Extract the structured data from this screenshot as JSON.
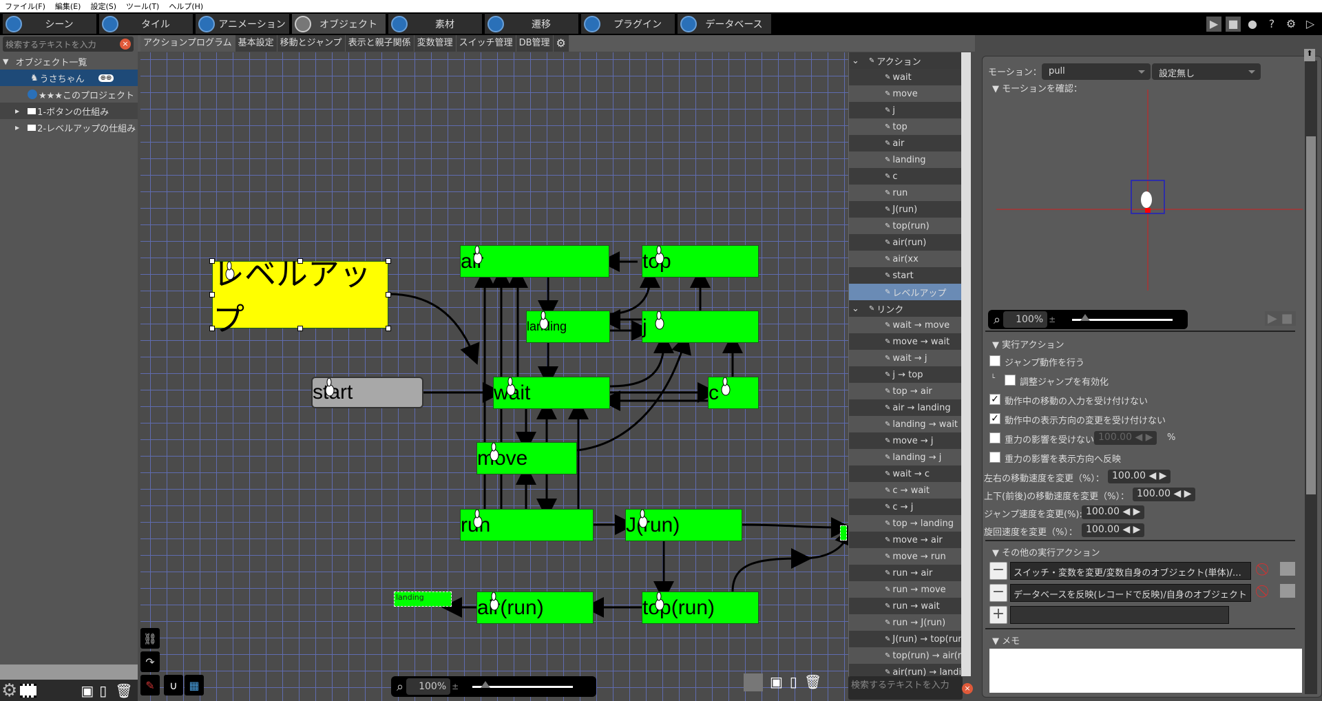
{
  "menu": [
    "ファイル(F)",
    "編集(E)",
    "設定(S)",
    "ツール(T)",
    "ヘルプ(H)"
  ],
  "main_tabs": [
    {
      "label": "シーン",
      "icon": "scene-icon"
    },
    {
      "label": "タイル",
      "icon": "tile-icon"
    },
    {
      "label": "アニメーション",
      "icon": "animation-icon"
    },
    {
      "label": "オブジェクト",
      "icon": "object-icon",
      "active": true
    },
    {
      "label": "素材",
      "icon": "material-icon"
    },
    {
      "label": "遷移",
      "icon": "transition-icon"
    },
    {
      "label": "プラグイン",
      "icon": "plugin-icon"
    },
    {
      "label": "データベース",
      "icon": "database-icon"
    }
  ],
  "left": {
    "search_placeholder": "検索するテキストを入力",
    "tree": [
      {
        "label": "オブジェクト一覧",
        "expanded": true
      },
      {
        "label": "うさちゃん",
        "selected": true,
        "badge": "gamepad-icon"
      },
      {
        "label": "★★★このプロジェクト"
      },
      {
        "label": "1-ボタンの仕組み",
        "folder": true
      },
      {
        "label": "2-レベルアップの仕組み",
        "folder": true
      }
    ]
  },
  "sub_tabs": [
    "アクションプログラム",
    "基本設定",
    "移動とジャンプ",
    "表示と親子関係",
    "変数管理",
    "スイッチ管理",
    "DB管理"
  ],
  "graph": {
    "nodes": [
      {
        "id": "levelup",
        "label": "レベルアップ",
        "color": "#ffff00",
        "selected": true
      },
      {
        "id": "start",
        "label": "start",
        "color": "#a8a8a8"
      },
      {
        "id": "air",
        "label": "air",
        "color": "#00ff00"
      },
      {
        "id": "top",
        "label": "top",
        "color": "#00ff00"
      },
      {
        "id": "landing",
        "label": "landing",
        "color": "#00ff00"
      },
      {
        "id": "j",
        "label": "j",
        "color": "#00ff00"
      },
      {
        "id": "wait",
        "label": "wait",
        "color": "#00ff00"
      },
      {
        "id": "c",
        "label": "c",
        "color": "#00ff00"
      },
      {
        "id": "move",
        "label": "move",
        "color": "#00ff00"
      },
      {
        "id": "run",
        "label": "run",
        "color": "#00ff00"
      },
      {
        "id": "jrun",
        "label": "J(run)",
        "color": "#00ff00"
      },
      {
        "id": "airrun",
        "label": "air(run)",
        "color": "#00ff00"
      },
      {
        "id": "toprun",
        "label": "top(run)",
        "color": "#00ff00"
      }
    ],
    "ghost_label": "landing",
    "zoom": "100%"
  },
  "action_list": {
    "actions_header": "アクション",
    "actions": [
      "wait",
      "move",
      "j",
      "top",
      "air",
      "landing",
      "c",
      "run",
      "J(run)",
      "top(run)",
      "air(run)",
      "air(xx",
      "start",
      "レベルアップ"
    ],
    "selected_action": "レベルアップ",
    "links_header": "リンク",
    "links": [
      "wait → move",
      "move → wait",
      "wait → j",
      "j → top",
      "top → air",
      "air → landing",
      "landing → wait",
      "move → j",
      "landing → j",
      "wait → c",
      "c → wait",
      "c → j",
      "top → landing",
      "move → air",
      "move → run",
      "run → air",
      "run → move",
      "run → wait",
      "run → J(run)",
      "J(run) → top(run)",
      "top(run) → air(run)",
      "air(run) → landing"
    ],
    "search_placeholder": "検索するテキストを入力"
  },
  "right": {
    "motion_label": "モーション：",
    "motion_value": "pull",
    "motion_option2": "設定無し",
    "preview_label": "モーションを確認：",
    "preview_zoom": "100%",
    "exec_section": "実行アクション",
    "checkboxes": [
      {
        "label": "ジャンプ動作を行う",
        "checked": false
      },
      {
        "label": "調整ジャンプを有効化",
        "checked": false
      },
      {
        "label": "動作中の移動の入力を受け付けない",
        "checked": true
      },
      {
        "label": "動作中の表示方向の変更を受け付けない",
        "checked": true
      },
      {
        "label": "重力の影響を受けない",
        "checked": false
      },
      {
        "label": "重力の影響を表示方向へ反映",
        "checked": false
      }
    ],
    "gravity_value": "100.00",
    "gravity_unit": "%",
    "speeds": [
      {
        "label": "左右の移動速度を変更（%）：",
        "value": "100.00"
      },
      {
        "label": "上下(前後)の移動速度を変更（%）：",
        "value": "100.00"
      },
      {
        "label": "ジャンプ速度を変更(%):",
        "value": "100.00"
      },
      {
        "label": "旋回速度を変更（%）：",
        "value": "100.00"
      }
    ],
    "other_section": "その他の実行アクション",
    "other_actions": [
      "スイッチ・変数を変更/変数自身のオブジェクト(単体)/…",
      "データベースを反映(レコードで反映)/自身のオブジェクト"
    ],
    "memo_section": "メモ",
    "memo_value": ""
  },
  "colors": {
    "node_green": "#00ff00",
    "node_selected": "#ffff00",
    "grid": "#5f6cb0",
    "accent_blue": "#1e4a78"
  }
}
